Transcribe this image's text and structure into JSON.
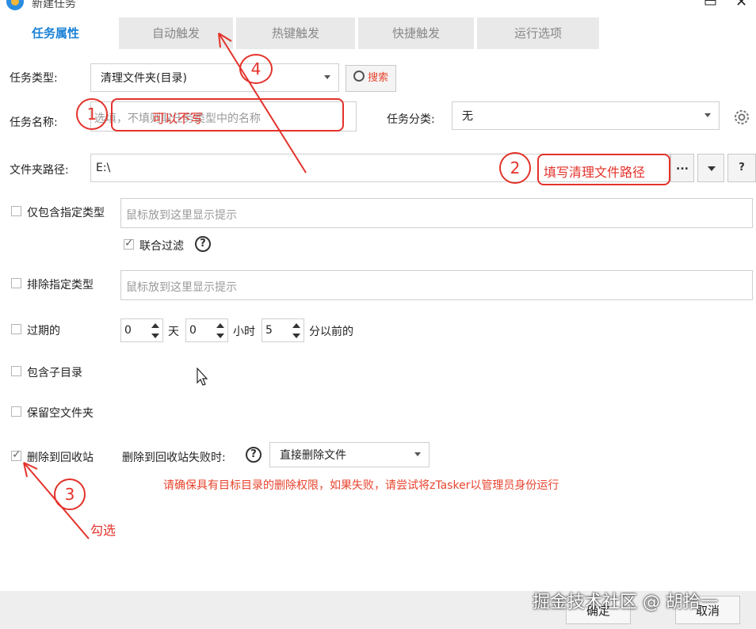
{
  "window": {
    "title": "新建任务"
  },
  "tabs": [
    "任务属性",
    "自动触发",
    "热键触发",
    "快捷触发",
    "运行选项"
  ],
  "form": {
    "task_type_label": "任务类型:",
    "task_type_value": "清理文件夹(目录)",
    "search_label": "搜索",
    "task_name_label": "任务名称:",
    "task_name_placeholder": "选填，不填则取任务类型中的名称",
    "task_category_label": "任务分类:",
    "task_category_value": "无",
    "folder_path_label": "文件夹路径:",
    "folder_path_value": "E:\\",
    "browse_label": "...",
    "help_label": "?",
    "include_types_label": "仅包含指定类型",
    "include_types_placeholder": "鼠标放到这里显示提示",
    "joint_filter_label": "联合过滤",
    "exclude_types_label": "排除指定类型",
    "exclude_types_placeholder": "鼠标放到这里显示提示",
    "expired_label": "过期的",
    "days_value": "0",
    "days_unit": "天",
    "hours_value": "0",
    "hours_unit": "小时",
    "minutes_value": "5",
    "minutes_unit": "分以前的",
    "include_subdirs_label": "包含子目录",
    "keep_empty_label": "保留空文件夹",
    "recycle_label": "删除到回收站",
    "recycle_fail_label": "删除到回收站失败时:",
    "recycle_fail_value": "直接删除文件",
    "warning": "请确保具有目标目录的删除权限，如果失败，请尝试将zTasker以管理员身份运行"
  },
  "checkboxes": {
    "include_types": false,
    "joint_filter": true,
    "exclude_types": false,
    "expired": false,
    "include_subdirs": false,
    "keep_empty": false,
    "recycle": true
  },
  "footer": {
    "ok_label": "确定",
    "cancel_label": "取消"
  },
  "annotations": {
    "n1": "1",
    "n2": "2",
    "n3": "3",
    "n4": "4",
    "note_optional": "可以不写",
    "note_path": "填写清理文件路径",
    "note_check": "勾选"
  },
  "watermark": "掘金技术社区 @ 胡拾一",
  "colors": {
    "accent": "#1a82d6",
    "annotation": "#e3322a",
    "warning": "#e8432e"
  }
}
